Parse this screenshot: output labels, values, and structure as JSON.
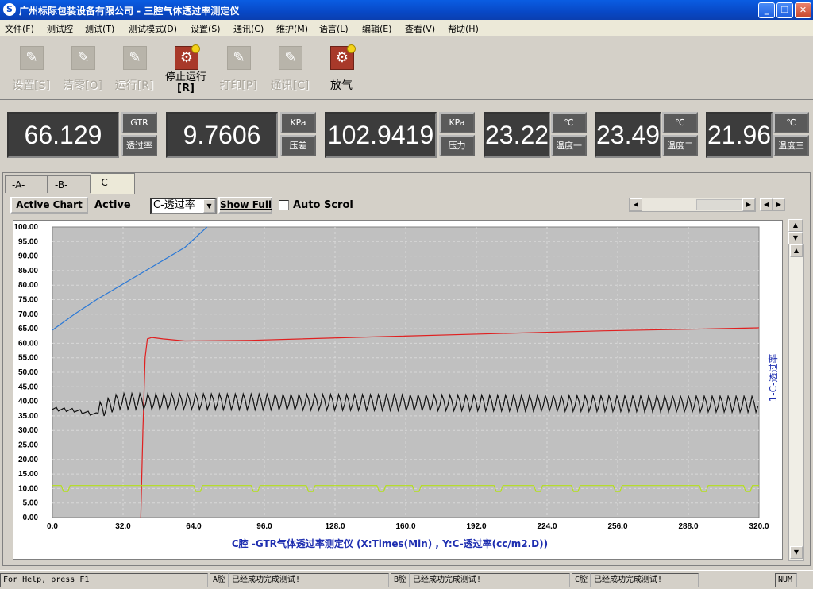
{
  "window": {
    "title": "广州标际包装设备有限公司 - 三腔气体透过率测定仪"
  },
  "menu": [
    "文件(F)",
    "测试腔",
    "测试(T)",
    "测试模式(D)",
    "设置(S)",
    "通讯(C)",
    "维护(M)",
    "语言(L)",
    "编辑(E)",
    "查看(V)",
    "帮助(H)"
  ],
  "toolbar": {
    "settings": "设置[S]",
    "zero": "清零[O]",
    "run": "运行[R]",
    "stop_run": "停止运行",
    "stop_run_key": "[R]",
    "print": "打印[P]",
    "comm": "通讯[C]",
    "vent": "放气"
  },
  "readouts": [
    {
      "value": "66.129",
      "unit": "GTR",
      "name": "透过率"
    },
    {
      "value": "9.7606",
      "unit": "KPa",
      "name": "压差"
    },
    {
      "value": "102.9419",
      "unit": "KPa",
      "name": "压力"
    },
    {
      "value": "23.22",
      "unit": "℃",
      "name": "温度一"
    },
    {
      "value": "23.49",
      "unit": "℃",
      "name": "温度二"
    },
    {
      "value": "21.96",
      "unit": "℃",
      "name": "温度三"
    }
  ],
  "tabs": [
    "-A-",
    "-B-",
    "-C-"
  ],
  "controls": {
    "active_chart": "Active Chart",
    "active_label": "Active",
    "series_select": "C-透过率",
    "show_full": "Show Full",
    "auto_scroll": "Auto Scrol"
  },
  "chart_data": {
    "type": "line",
    "title": "C腔 -GTR气体透过率测定仪  (X:Times(Min) , Y:C-透过率(cc/m2.D))",
    "right_label": "1-C-透过率",
    "xlim": [
      0,
      320
    ],
    "ylim": [
      0,
      100
    ],
    "x_ticks": [
      "0.0",
      "32.0",
      "64.0",
      "96.0",
      "128.0",
      "160.0",
      "192.0",
      "224.0",
      "256.0",
      "288.0",
      "320.0"
    ],
    "y_ticks": [
      "0.00",
      "5.00",
      "10.00",
      "15.00",
      "20.00",
      "25.00",
      "30.00",
      "35.00",
      "40.00",
      "45.00",
      "50.00",
      "55.00",
      "60.00",
      "65.00",
      "70.00",
      "75.00",
      "80.00",
      "85.00",
      "90.00",
      "95.00",
      "100.00"
    ],
    "grid": true,
    "series": [
      {
        "color": "#2a78d6",
        "x": [
          0,
          10,
          20,
          40,
          60,
          70
        ],
        "values": [
          64.5,
          70,
          75,
          84,
          93,
          100
        ]
      },
      {
        "color": "#e02020",
        "x": [
          40,
          41,
          42,
          43,
          45,
          50,
          60,
          90,
          150,
          200,
          250,
          300,
          320
        ],
        "values": [
          0,
          30,
          55,
          61.5,
          62,
          61.5,
          60.8,
          61.0,
          62.3,
          63.3,
          64.3,
          65.0,
          65.3
        ]
      },
      {
        "color": "#101010",
        "x": [
          0,
          10,
          20,
          30,
          320
        ],
        "values": [
          38.5,
          38,
          36.5,
          40,
          39
        ],
        "oscillation": {
          "start": 20,
          "period": 3.6,
          "amplitude": 3.5
        }
      },
      {
        "color": "#b4e01a",
        "x": [
          0,
          320
        ],
        "values": [
          11,
          11
        ],
        "dips": [
          6,
          66,
          92,
          117,
          149,
          165,
          202,
          220,
          237,
          256,
          295,
          315
        ]
      }
    ]
  },
  "status": {
    "help": "For Help, press F1",
    "a_label": "A腔",
    "a_text": "已经成功完成测试!",
    "b_label": "B腔",
    "b_text": "已经成功完成测试!",
    "c_label": "C腔",
    "c_text": "已经成功完成测试!",
    "num": "NUM"
  }
}
